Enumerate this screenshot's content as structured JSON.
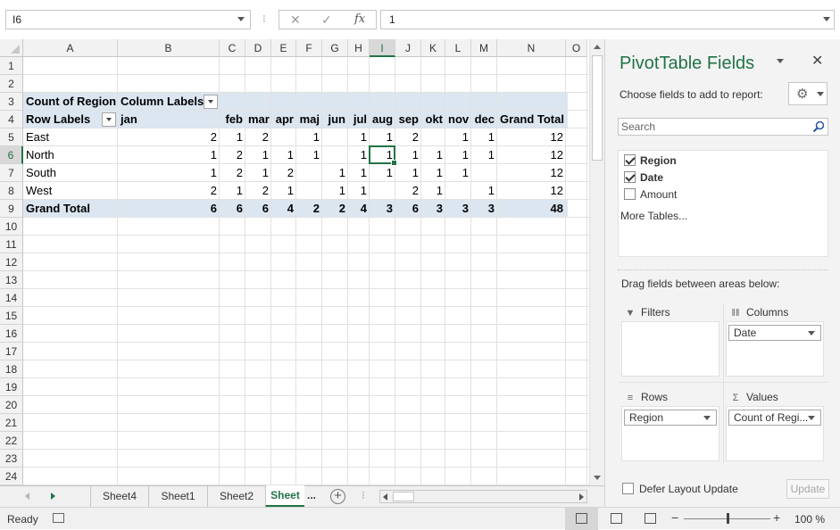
{
  "formula_bar": {
    "name_box": "I6",
    "separator": "⁝",
    "cancel_glyph": "✕",
    "enter_glyph": "✓",
    "fx_glyph": "fx",
    "formula_value": "1"
  },
  "grid": {
    "active_cell": "I6",
    "columns": [
      "A",
      "B",
      "C",
      "D",
      "E",
      "F",
      "G",
      "H",
      "I",
      "J",
      "K",
      "L",
      "M",
      "N",
      "O"
    ],
    "rows": [
      "1",
      "2",
      "3",
      "4",
      "5",
      "6",
      "7",
      "8",
      "9",
      "10",
      "11",
      "12",
      "13",
      "14",
      "15",
      "16",
      "17",
      "18",
      "19",
      "20",
      "21",
      "22",
      "23",
      "24"
    ]
  },
  "pivot": {
    "count_label": "Count of Region",
    "column_labels": "Column Labels",
    "row_labels": "Row Labels",
    "months": [
      "jan",
      "feb",
      "mar",
      "apr",
      "maj",
      "jun",
      "jul",
      "aug",
      "sep",
      "okt",
      "nov",
      "dec"
    ],
    "grand_total_header": "Grand Total",
    "rows": [
      {
        "label": "East",
        "values": [
          "2",
          "1",
          "2",
          "",
          "1",
          "",
          "1",
          "1",
          "2",
          "",
          "1",
          "1"
        ],
        "total": "12"
      },
      {
        "label": "North",
        "values": [
          "1",
          "2",
          "1",
          "1",
          "1",
          "",
          "1",
          "1",
          "1",
          "1",
          "1",
          "1"
        ],
        "total": "12"
      },
      {
        "label": "South",
        "values": [
          "1",
          "2",
          "1",
          "2",
          "",
          "1",
          "1",
          "1",
          "1",
          "1",
          "1",
          ""
        ],
        "total": "12"
      },
      {
        "label": "West",
        "values": [
          "2",
          "1",
          "2",
          "1",
          "",
          "1",
          "1",
          "",
          "2",
          "1",
          "",
          "1"
        ],
        "total": "12"
      }
    ],
    "grand_total_label": "Grand Total",
    "grand_total_values": [
      "6",
      "6",
      "6",
      "4",
      "2",
      "2",
      "4",
      "3",
      "6",
      "3",
      "3",
      "3"
    ],
    "grand_total_total": "48"
  },
  "sheet_tabs": {
    "tabs": [
      "Sheet4",
      "Sheet1",
      "Sheet2",
      "Sheet"
    ],
    "active_index": 3,
    "overflow": "...",
    "add_glyph": "+"
  },
  "pivot_pane": {
    "title": "PivotTable Fields",
    "close_glyph": "✕",
    "choose_label": "Choose fields to add to report:",
    "gear_glyph": "⚙",
    "search_placeholder": "Search",
    "fields": [
      {
        "name": "Region",
        "checked": true
      },
      {
        "name": "Date",
        "checked": true
      },
      {
        "name": "Amount",
        "checked": false
      }
    ],
    "more_tables": "More Tables...",
    "drag_label": "Drag fields between areas below:",
    "areas": {
      "filters": {
        "label": "Filters",
        "icon": "filter-icon",
        "items": []
      },
      "columns": {
        "label": "Columns",
        "icon": "columns-icon",
        "items": [
          "Date"
        ]
      },
      "rows": {
        "label": "Rows",
        "icon": "rows-icon",
        "items": [
          "Region"
        ]
      },
      "values": {
        "label": "Values",
        "icon": "sigma-icon",
        "items": [
          "Count of Regi..."
        ]
      }
    },
    "defer_label": "Defer Layout Update",
    "update_label": "Update"
  },
  "status_bar": {
    "status": "Ready",
    "zoom_minus": "−",
    "zoom_plus": "+",
    "zoom": "100 %",
    "zoom_fraction": 0.5
  },
  "colors": {
    "accent": "#217346",
    "pivot_band": "#dce6f1",
    "pane_background": "#f3f3f3"
  }
}
